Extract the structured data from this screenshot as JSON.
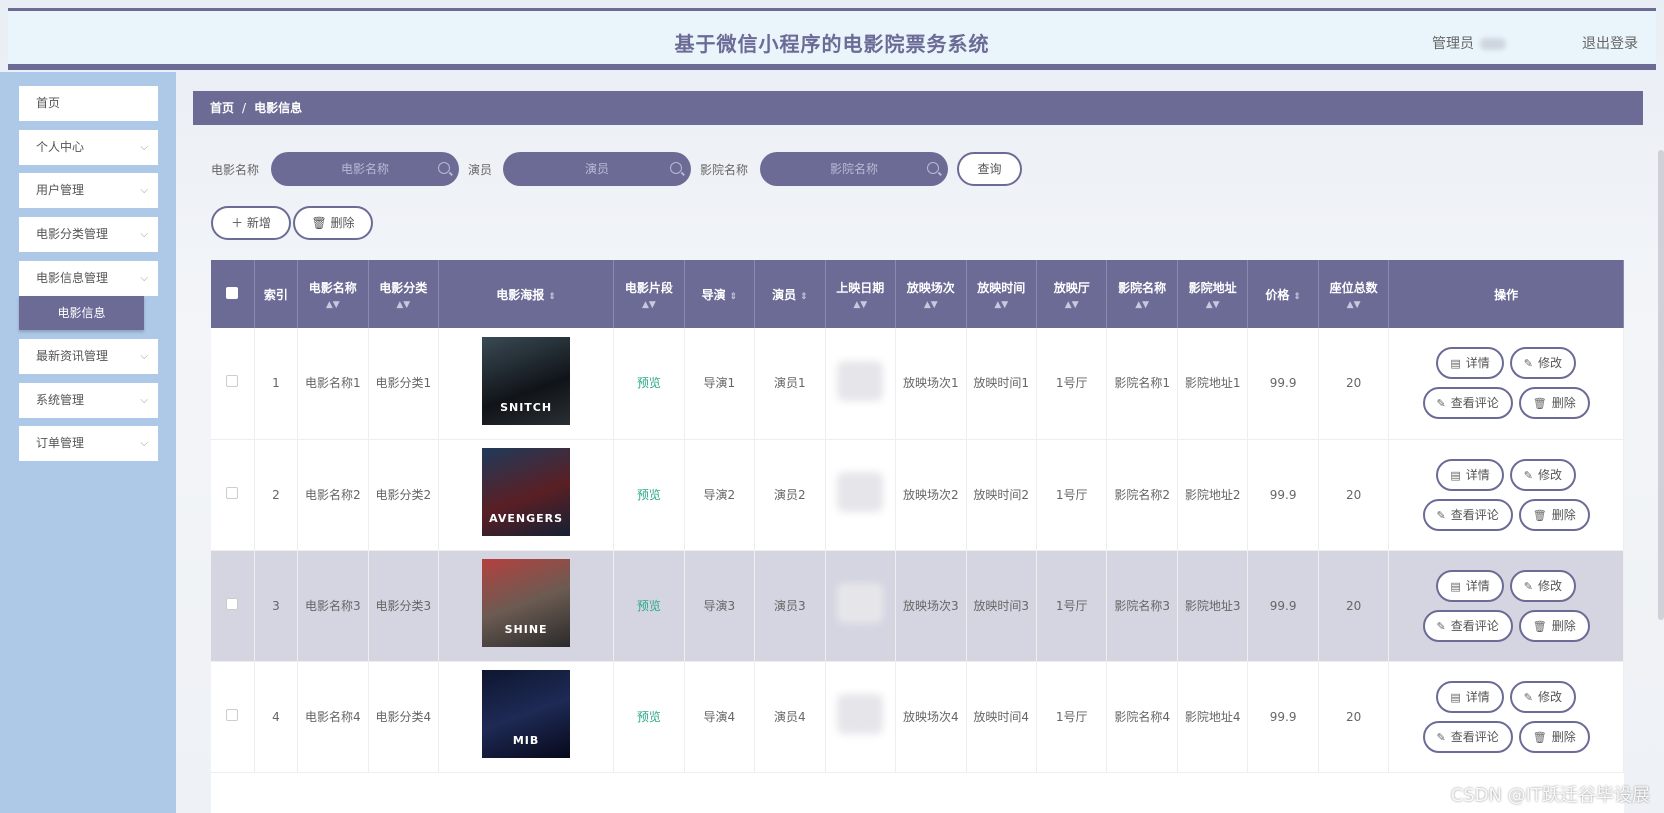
{
  "header": {
    "title": "基于微信小程序的电影院票务系统",
    "admin_label": "管理员",
    "logout": "退出登录"
  },
  "sidebar": {
    "items": [
      {
        "label": "首页"
      },
      {
        "label": "个人中心"
      },
      {
        "label": "用户管理"
      },
      {
        "label": "电影分类管理"
      },
      {
        "label": "电影信息管理"
      },
      {
        "label": "最新资讯管理"
      },
      {
        "label": "系统管理"
      },
      {
        "label": "订单管理"
      }
    ],
    "active_sub": "电影信息"
  },
  "breadcrumb": {
    "home": "首页",
    "sep": "/",
    "current": "电影信息"
  },
  "search": {
    "movie_name_label": "电影名称",
    "movie_name_placeholder": "电影名称",
    "actor_label": "演员",
    "actor_placeholder": "演员",
    "cinema_label": "影院名称",
    "cinema_placeholder": "影院名称",
    "query": "查询"
  },
  "actions": {
    "add": "新增",
    "delete": "删除"
  },
  "table": {
    "headers": {
      "index": "索引",
      "name": "电影名称",
      "category": "电影分类",
      "poster": "电影海报",
      "clip": "电影片段",
      "director": "导演",
      "actor": "演员",
      "date": "上映日期",
      "session": "放映场次",
      "time": "放映时间",
      "hall": "放映厅",
      "cinema": "影院名称",
      "address": "影院地址",
      "price": "价格",
      "seats": "座位总数",
      "ops": "操作"
    },
    "rows": [
      {
        "index": "1",
        "name": "电影名称1",
        "category": "电影分类1",
        "poster": "SNITCH",
        "clip": "预览",
        "director": "导演1",
        "actor": "演员1",
        "session": "放映场次1",
        "time": "放映时间1",
        "hall": "1号厅",
        "cinema": "影院名称1",
        "address": "影院地址1",
        "price": "99.9",
        "seats": "20"
      },
      {
        "index": "2",
        "name": "电影名称2",
        "category": "电影分类2",
        "poster": "AVENGERS",
        "clip": "预览",
        "director": "导演2",
        "actor": "演员2",
        "session": "放映场次2",
        "time": "放映时间2",
        "hall": "1号厅",
        "cinema": "影院名称2",
        "address": "影院地址2",
        "price": "99.9",
        "seats": "20"
      },
      {
        "index": "3",
        "name": "电影名称3",
        "category": "电影分类3",
        "poster": "SHINE",
        "clip": "预览",
        "director": "导演3",
        "actor": "演员3",
        "session": "放映场次3",
        "time": "放映时间3",
        "hall": "1号厅",
        "cinema": "影院名称3",
        "address": "影院地址3",
        "price": "99.9",
        "seats": "20"
      },
      {
        "index": "4",
        "name": "电影名称4",
        "category": "电影分类4",
        "poster": "MIB",
        "clip": "预览",
        "director": "导演4",
        "actor": "演员4",
        "session": "放映场次4",
        "time": "放映时间4",
        "hall": "1号厅",
        "cinema": "影院名称4",
        "address": "影院地址4",
        "price": "99.9",
        "seats": "20"
      }
    ],
    "ops": {
      "detail": "详情",
      "edit": "修改",
      "comments": "查看评论",
      "remove": "删除"
    }
  },
  "watermark": "CSDN @IT跃迁谷毕设展"
}
